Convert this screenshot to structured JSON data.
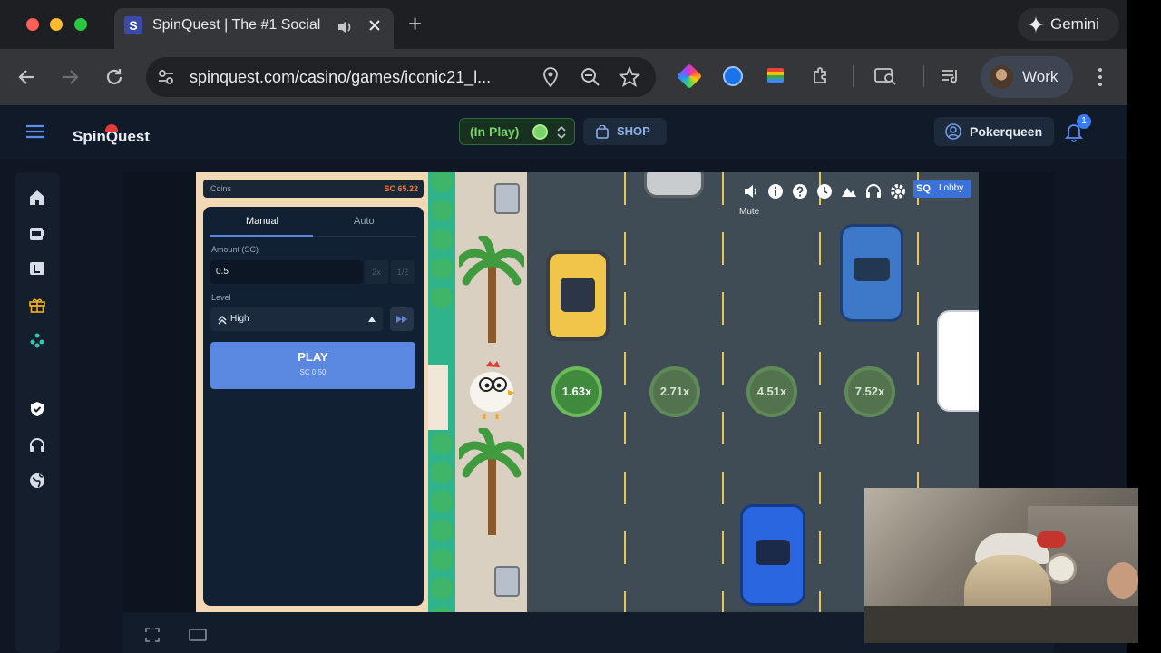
{
  "browser": {
    "tab_title": "SpinQuest | The #1 Social",
    "tab_favicon": "S",
    "new_tab": "+",
    "gemini_label": "Gemini",
    "url": "spinquest.com/casino/games/iconic21_l...",
    "profile_label": "Work"
  },
  "site": {
    "logo": "SpinQuest",
    "in_play_label": "(In Play)",
    "shop_label": "SHOP",
    "username": "Pokerqueen",
    "notification_count": "1"
  },
  "game": {
    "coins_label": "Coins",
    "coins_value": "SC 65.22",
    "tabs": [
      "Manual",
      "Auto"
    ],
    "amount_label": "Amount (SC)",
    "amount_value": "0.5",
    "double_label": "2x",
    "half_label": "1/2",
    "level_label": "Level",
    "level_value": "High",
    "play_label": "PLAY",
    "play_sub": "SC 0.50",
    "multipliers": [
      "1.63x",
      "2.71x",
      "4.51x",
      "7.52x"
    ],
    "lobby_label": "Lobby",
    "lobby_logo": "SQ",
    "tooltip": "Mute"
  },
  "colors": {
    "accent": "#5a87e0",
    "coins": "#f07a3a",
    "multiplier_active": "#3f8a3d"
  }
}
